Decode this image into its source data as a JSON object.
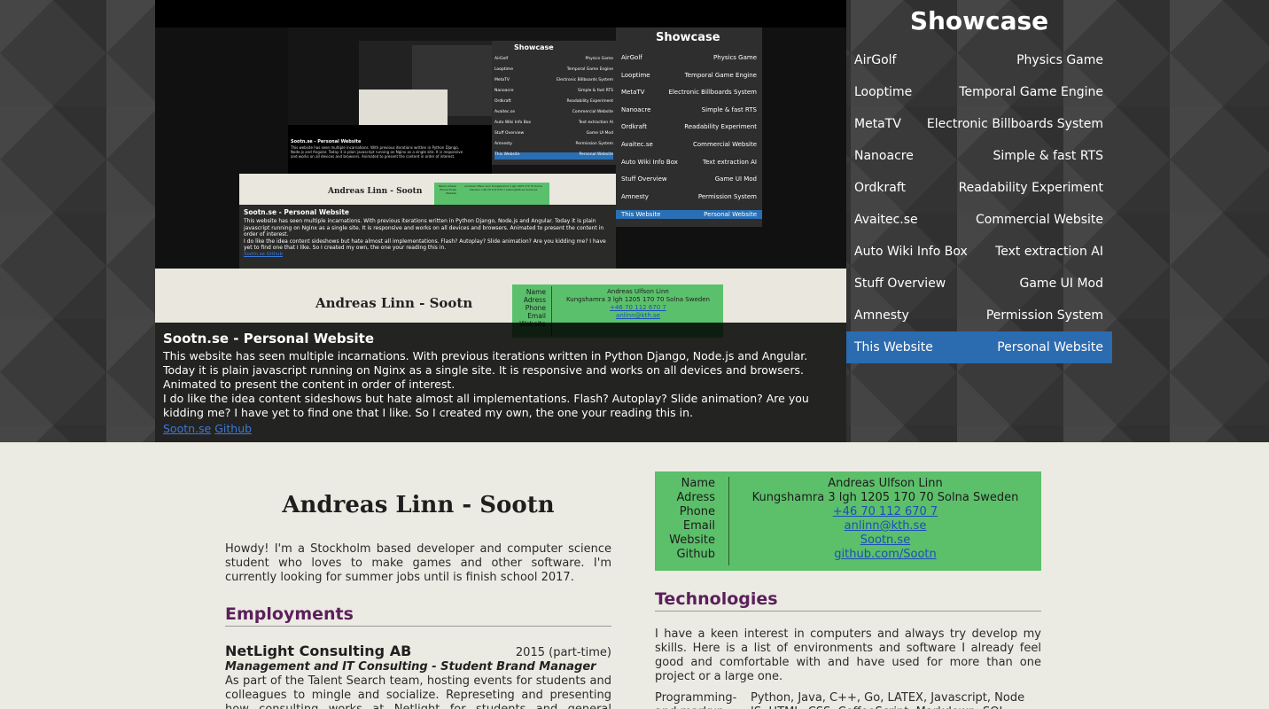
{
  "showcase": {
    "title": "Showcase",
    "items": [
      {
        "name": "AirGolf",
        "desc": "Physics Game"
      },
      {
        "name": "Looptime",
        "desc": "Temporal Game Engine"
      },
      {
        "name": "MetaTV",
        "desc": "Electronic Billboards System"
      },
      {
        "name": "Nanoacre",
        "desc": "Simple & fast RTS"
      },
      {
        "name": "Ordkraft",
        "desc": "Readability Experiment"
      },
      {
        "name": "Avaitec.se",
        "desc": "Commercial Website"
      },
      {
        "name": "Auto Wiki Info Box",
        "desc": "Text extraction AI"
      },
      {
        "name": "Stuff Overview",
        "desc": "Game UI Mod"
      },
      {
        "name": "Amnesty",
        "desc": "Permission System"
      },
      {
        "name": "This Website",
        "desc": "Personal Website",
        "active": true
      }
    ],
    "active_color": "#2b6bb0"
  },
  "caption": {
    "title": "Sootn.se - Personal Website",
    "p1": "This website has seen multiple incarnations. With previous iterations written in Python Django, Node.js and Angular. Today it is plain javascript running on Nginx as a single site. It is responsive and works on all devices and browsers. Animated to present the content in order of interest.",
    "p2": "I do like the idea content sideshows but hate almost all implementations. Flash? Autoplay? Slide animation? Are you kidding me? I have yet to find one that I like. So I created my own, the one your reading this in.",
    "link1": "Sootn.se",
    "link2": "Github"
  },
  "cv": {
    "name": "Andreas Linn - Sootn",
    "intro": "Howdy! I'm a Stockholm based developer and computer science student who loves to make games and other software. I'm currently looking for summer jobs until is finish school 2017.",
    "employments_heading": "Employments",
    "jobs": [
      {
        "company": "NetLight Consulting AB",
        "period": "2015 (part-time)",
        "role": "Management and IT Consulting - Student Brand Manager",
        "desc": "As part of the Talent Search team, hosting events for students and colleagues to mingle and socialize. Represeting and presenting how consulting works at Netlight for students and general branding."
      }
    ],
    "contact": {
      "labels": [
        "Name",
        "Adress",
        "Phone",
        "Email",
        "Website",
        "Github"
      ],
      "name": "Andreas Ulfson Linn",
      "address": "Kungshamra 3 lgh 1205 170 70 Solna Sweden",
      "phone": "+46 70 112 670 7",
      "email": "anlinn@kth.se",
      "website": "Sootn.se",
      "github": "github.com/Sootn",
      "bg_color": "#5cbf6a"
    },
    "technologies_heading": "Technologies",
    "tech_intro": "I have a keen interest in computers and always try develop my skills. Here is a list of environments and software I already feel good and comfortable with and have used for more than one project or a large one.",
    "tech_rows": [
      {
        "label": "Programming- and markup",
        "value": "Python, Java, C++, Go, LATEX, Javascript, Node JS, HTML, CSS, CoffeeScript, Markdown, SQL"
      }
    ],
    "heading_color": "#5b1f5b"
  },
  "thumbnail": {
    "showcase_title": "Showcase",
    "cv_name": "Andreas Linn - Sootn",
    "caption_title": "Sootn.se - Personal Website",
    "caption_text": "This website has seen multiple incarnations. With previous iterations written in Python Django, Node.js and Angular. Today it is plain javascript running on Nginx as a single site. It is responsive and works on all devices and browsers. Animated to present the content in order of interest.",
    "caption_text2": "I do like the idea content sideshows but hate almost all implementations. Flash? Autoplay? Slide animation? Are you kidding me? I have yet to find one that I like. So I created my own, the one your reading this in.",
    "caption_links": "Sootn.se Github",
    "contact_labels": "Name Adress Phone Email Website",
    "contact_values": "Andreas Ulfson Linn Kungshamra 3 lgh 1205 170 70 Solna Sweden +46 70 112 670 7 anlinn@kth.se Sootn.se",
    "contact_name": "Andreas Ulfson Linn",
    "contact_address": "Kungshamra 3 lgh 1205 170 70 Solna Sweden",
    "contact_phone": "+46 70 112 670 7",
    "contact_email": "anlinn@kth.se"
  }
}
